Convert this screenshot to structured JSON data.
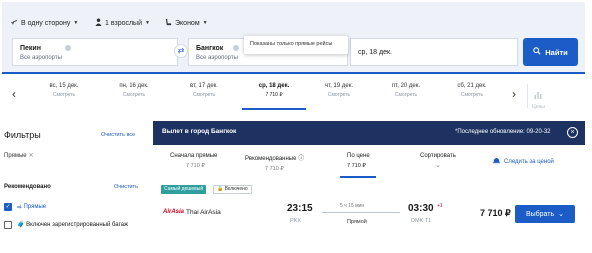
{
  "search": {
    "trip_type": "В одну сторону",
    "passengers": "1 взрослый",
    "cabin_class": "Эконом",
    "from": {
      "city": "Пекин",
      "airports": "Все аэропорты"
    },
    "to": {
      "city": "Бангкок",
      "airports": "Все аэропорты"
    },
    "date": "ср, 18 дек.",
    "tooltip": "Показаны только прямые рейсы",
    "button": "Найти",
    "icons": {
      "trip": "plane-icon",
      "passenger": "person-icon",
      "cabin": "seat-icon",
      "swap": "swap-arrows-icon",
      "search": "magnifier-icon"
    }
  },
  "date_strip": {
    "items": [
      {
        "date": "вс, 15 дек.",
        "price": "Смотреть"
      },
      {
        "date": "пн, 16 дек.",
        "price": "Смотреть"
      },
      {
        "date": "вт, 17 дек.",
        "price": "Смотреть"
      },
      {
        "date": "ср, 18 дек.",
        "price": "7 710 ₽"
      },
      {
        "date": "чт, 19 дек.",
        "price": "Смотреть"
      },
      {
        "date": "пт, 20 дек.",
        "price": "Смотреть"
      },
      {
        "date": "сб, 21 дек.",
        "price": "Смотреть"
      }
    ],
    "chart_label": "Цены"
  },
  "filters": {
    "title": "Фильтры",
    "clear_all": "Очистить все",
    "active_chip": "Прямые",
    "recommended_title": "Рекомендовано",
    "recommended_clear": "Очистить",
    "options": [
      {
        "label": "Прямые",
        "checked": true
      },
      {
        "label": "Включен зарегистрированный багаж",
        "checked": false
      }
    ]
  },
  "results": {
    "header_title": "Вылет в город Бангкок",
    "last_updated": "*Последнее обновление: 09-20-32",
    "tabs": [
      {
        "label": "Сначала прямые",
        "price": "7 710 ₽"
      },
      {
        "label": "Рекомендованные",
        "price": "7 710 ₽"
      },
      {
        "label": "По цене",
        "price": "7 710 ₽"
      }
    ],
    "sort_label": "Сортировать",
    "watch_price": "Следить за ценой",
    "flight": {
      "badge_cheapest": "Самый дешевый",
      "badge_baggage": "Включено",
      "airline_logo": "AirAsia",
      "airline": "Thai AirAsia",
      "depart_time": "23:15",
      "depart_airport": "PKX",
      "duration": "5 ч 15 мин",
      "stops": "Прямой",
      "arrive_time": "03:30",
      "next_day": "+1",
      "arrive_airport": "DMK T1",
      "price": "7 710 ₽",
      "select": "Выбрать"
    }
  },
  "colors": {
    "accent": "#1b5cc7",
    "header_bg": "#1d3260",
    "badge": "#2e9e9e",
    "airline_red": "#d6001c"
  }
}
